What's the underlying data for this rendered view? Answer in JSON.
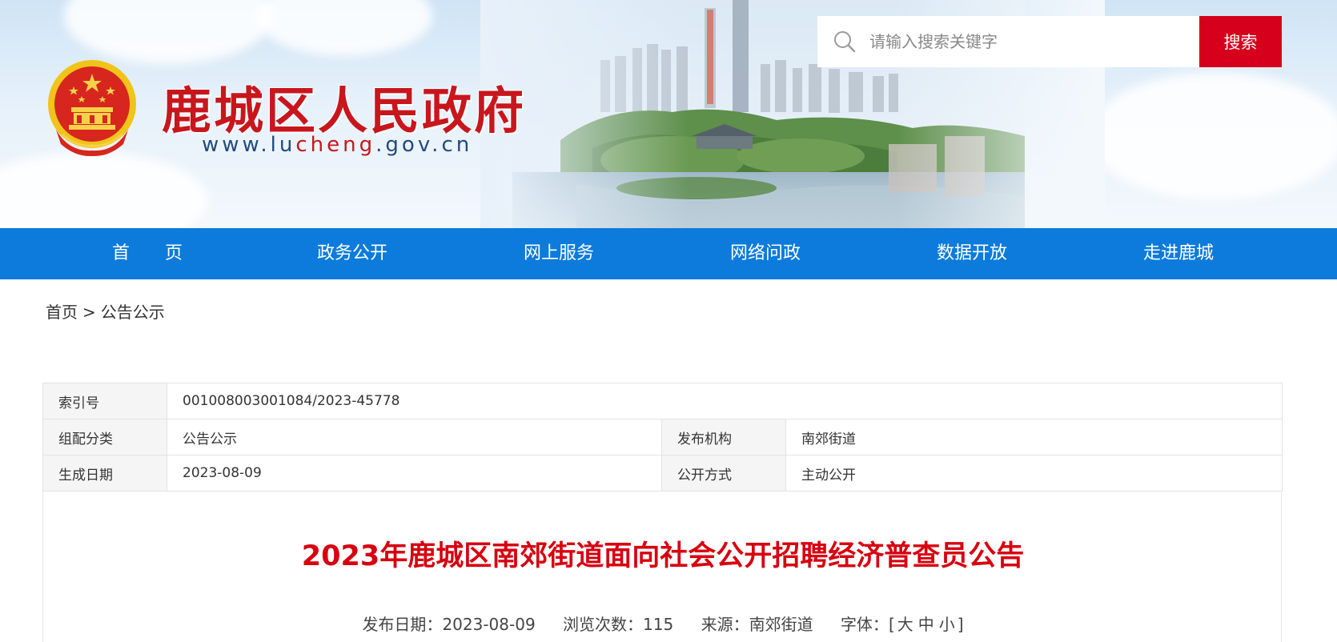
{
  "header": {
    "site_title": "鹿城区人民政府",
    "site_url_prefix": "www.lu",
    "site_url_highlight": "cheng",
    "site_url_suffix": ".gov.cn",
    "search": {
      "placeholder": "请输入搜索关键字",
      "button_label": "搜索"
    },
    "colors": {
      "brand_red": "#c8161d",
      "search_red": "#d7001c"
    }
  },
  "nav": {
    "color": "#0c7bdc",
    "items": [
      {
        "label": "首　　页"
      },
      {
        "label": "政务公开"
      },
      {
        "label": "网上服务"
      },
      {
        "label": "网络问政"
      },
      {
        "label": "数据开放"
      },
      {
        "label": "走进鹿城"
      }
    ]
  },
  "breadcrumb": {
    "home": "首页",
    "separator": ">",
    "current": "公告公示"
  },
  "info": {
    "index_label": "索引号",
    "index_value": "001008003001084/2023-45778",
    "category_label": "组配分类",
    "category_value": "公告公示",
    "publisher_label": "发布机构",
    "publisher_value": "南郊街道",
    "date_label": "生成日期",
    "date_value": "2023-08-09",
    "method_label": "公开方式",
    "method_value": "主动公开"
  },
  "article": {
    "title": "2023年鹿城区南郊街道面向社会公开招聘经济普查员公告",
    "meta": {
      "publish_date_label": "发布日期：",
      "publish_date": "2023-08-09",
      "views_label": "浏览次数：",
      "views": "115",
      "source_label": "来源：",
      "source": "南郊街道",
      "font_label": "字体：",
      "bracket_open": "[",
      "size_large": "大",
      "size_medium": "中",
      "size_small": "小",
      "bracket_close": "]"
    }
  }
}
